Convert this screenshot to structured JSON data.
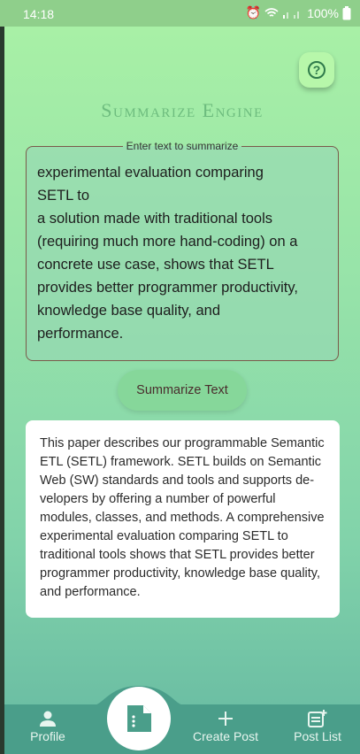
{
  "status_bar": {
    "time": "14:18",
    "battery": "100%"
  },
  "header": {
    "title": "Summarize Engine"
  },
  "input": {
    "legend": "Enter text to summarize",
    "value": "experimental evaluation comparing\nSETL to\na solution made with traditional tools\n(requiring much more hand-coding) on a\nconcrete use case, shows that SETL\nprovides better programmer productivity,\nknowledge base quality, and\nperformance."
  },
  "actions": {
    "summarize_label": "Summarize Text"
  },
  "result": {
    "text": "This paper describes our programmable Semantic ETL (SETL) framework. SETL builds on Semantic Web (SW) standards and tools and supports de-velopers by offering a number of powerful modules, classes, and methods. A comprehensive experimental evaluation comparing SETL to traditional tools shows that SETL provides better programmer productivity, knowledge base quality, and performance."
  },
  "nav": {
    "items": [
      {
        "label": "Profile",
        "icon": "person-icon"
      },
      {
        "label": "",
        "icon": "document-icon"
      },
      {
        "label": "Create Post",
        "icon": "plus-icon"
      },
      {
        "label": "Post List",
        "icon": "post-list-icon"
      }
    ]
  },
  "colors": {
    "accent": "#6dbc7e",
    "nav_bg": "#4a9e8a",
    "button_bg": "#86d79a"
  }
}
